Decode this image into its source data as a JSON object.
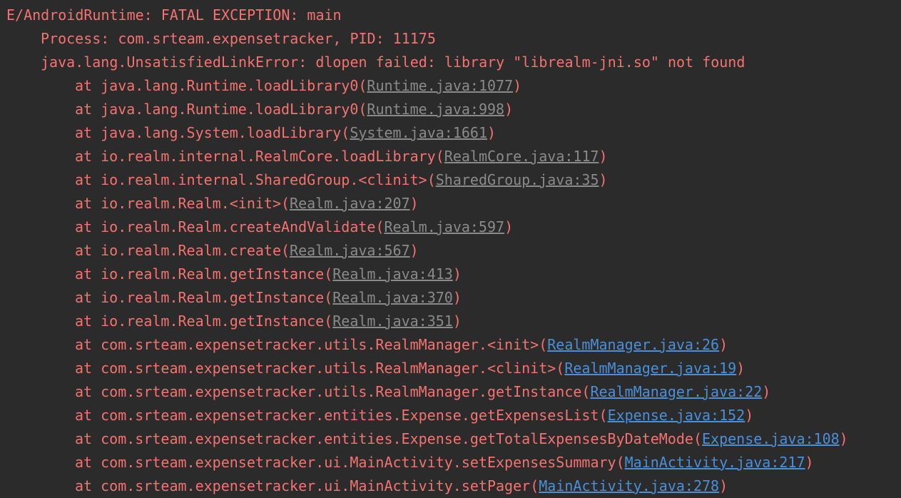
{
  "log": {
    "header": "E/AndroidRuntime: FATAL EXCEPTION: main",
    "process": "Process: com.srteam.expensetracker, PID: 11175",
    "exception": "java.lang.UnsatisfiedLinkError: dlopen failed: library \"librealm-jni.so\" not found",
    "frames": [
      {
        "method": "at java.lang.Runtime.loadLibrary0",
        "location": "Runtime.java:1077",
        "link_type": "library"
      },
      {
        "method": "at java.lang.Runtime.loadLibrary0",
        "location": "Runtime.java:998",
        "link_type": "library"
      },
      {
        "method": "at java.lang.System.loadLibrary",
        "location": "System.java:1661",
        "link_type": "library"
      },
      {
        "method": "at io.realm.internal.RealmCore.loadLibrary",
        "location": "RealmCore.java:117",
        "link_type": "library"
      },
      {
        "method": "at io.realm.internal.SharedGroup.<clinit>",
        "location": "SharedGroup.java:35",
        "link_type": "library"
      },
      {
        "method": "at io.realm.Realm.<init>",
        "location": "Realm.java:207",
        "link_type": "library"
      },
      {
        "method": "at io.realm.Realm.createAndValidate",
        "location": "Realm.java:597",
        "link_type": "library"
      },
      {
        "method": "at io.realm.Realm.create",
        "location": "Realm.java:567",
        "link_type": "library"
      },
      {
        "method": "at io.realm.Realm.getInstance",
        "location": "Realm.java:413",
        "link_type": "library"
      },
      {
        "method": "at io.realm.Realm.getInstance",
        "location": "Realm.java:370",
        "link_type": "library"
      },
      {
        "method": "at io.realm.Realm.getInstance",
        "location": "Realm.java:351",
        "link_type": "library"
      },
      {
        "method": "at com.srteam.expensetracker.utils.RealmManager.<init>",
        "location": "RealmManager.java:26",
        "link_type": "project"
      },
      {
        "method": "at com.srteam.expensetracker.utils.RealmManager.<clinit>",
        "location": "RealmManager.java:19",
        "link_type": "project"
      },
      {
        "method": "at com.srteam.expensetracker.utils.RealmManager.getInstance",
        "location": "RealmManager.java:22",
        "link_type": "project"
      },
      {
        "method": "at com.srteam.expensetracker.entities.Expense.getExpensesList",
        "location": "Expense.java:152",
        "link_type": "project"
      },
      {
        "method": "at com.srteam.expensetracker.entities.Expense.getTotalExpensesByDateMode",
        "location": "Expense.java:108",
        "link_type": "project"
      },
      {
        "method": "at com.srteam.expensetracker.ui.MainActivity.setExpensesSummary",
        "location": "MainActivity.java:217",
        "link_type": "project"
      },
      {
        "method": "at com.srteam.expensetracker.ui.MainActivity.setPager",
        "location": "MainActivity.java:278",
        "link_type": "project"
      }
    ]
  },
  "colors": {
    "background": "#2b2b2b",
    "error_text": "#f4726f",
    "library_link": "#8a8a8a",
    "project_link": "#4a8fd8"
  }
}
